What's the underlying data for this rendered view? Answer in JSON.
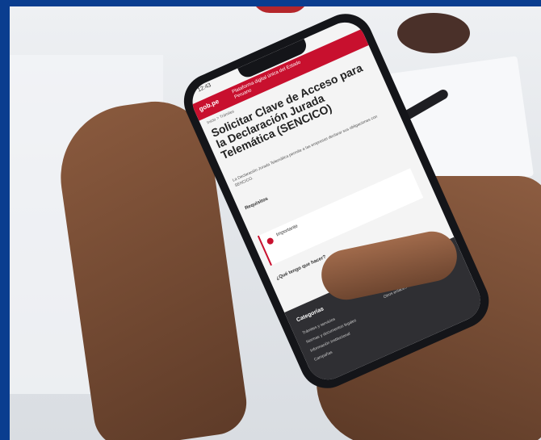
{
  "phone_screen": {
    "status_time": "12:43",
    "site_logo": "gob.pe",
    "header_text": "Plataforma digital única del Estado Peruano",
    "breadcrumb": "Inicio > Trámites",
    "title": "Solicitar Clave de Acceso para la Declaración Jurada Telemática (SENCICO)",
    "intro": "La Declaración Jurada Telemática permite a las empresas declarar sus obligaciones con SENCICO.",
    "section_heading": "Requisitos",
    "alert_title": "Importante",
    "steps_heading": "¿Qué tengo que hacer?",
    "footer_heading": "Categorías",
    "footer_links": [
      "Trámites y servicios",
      "Normas y documentos legales",
      "Información institucional",
      "Campañas",
      "Otros enlaces"
    ]
  },
  "colors": {
    "frame": "#0a3d8f",
    "brand_red": "#c8102e"
  }
}
